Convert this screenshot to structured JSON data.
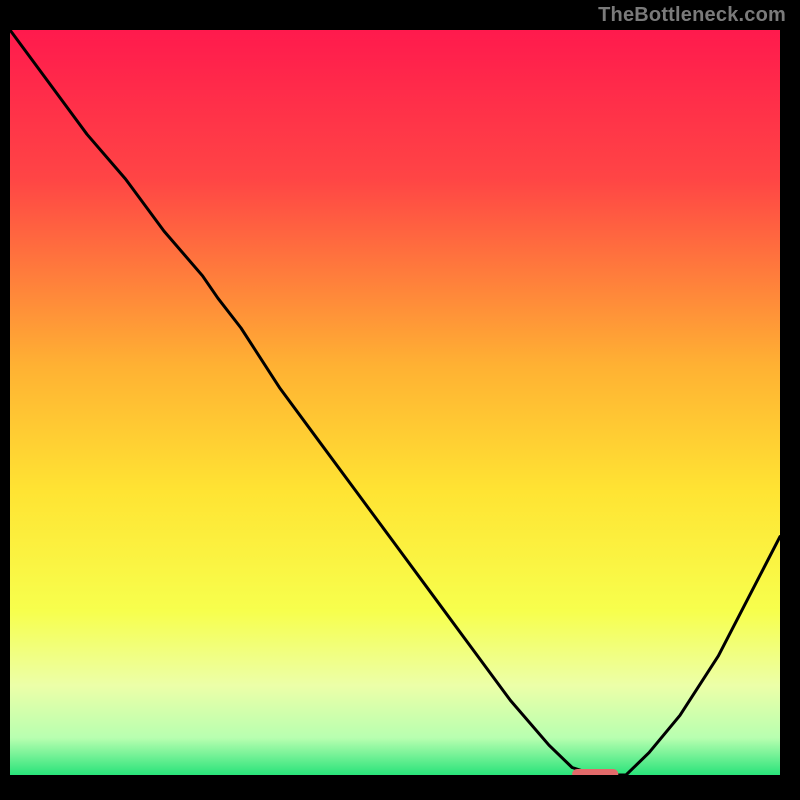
{
  "watermark": "TheBottleneck.com",
  "chart_data": {
    "type": "line",
    "title": "",
    "xlabel": "",
    "ylabel": "",
    "xlim": [
      0,
      100
    ],
    "ylim": [
      0,
      100
    ],
    "grid": false,
    "legend": false,
    "gradient_stops": [
      {
        "pos": 0.0,
        "color": "#ff1a4d"
      },
      {
        "pos": 0.2,
        "color": "#ff4545"
      },
      {
        "pos": 0.45,
        "color": "#ffb133"
      },
      {
        "pos": 0.62,
        "color": "#ffe433"
      },
      {
        "pos": 0.78,
        "color": "#f7ff4d"
      },
      {
        "pos": 0.88,
        "color": "#ecffa8"
      },
      {
        "pos": 0.95,
        "color": "#b8ffb0"
      },
      {
        "pos": 1.0,
        "color": "#29e37a"
      }
    ],
    "series": [
      {
        "name": "bottleneck-curve",
        "x": [
          0,
          5,
          10,
          15,
          20,
          25,
          27,
          30,
          35,
          40,
          45,
          50,
          55,
          60,
          65,
          70,
          73,
          76,
          78,
          80,
          83,
          87,
          92,
          96,
          100
        ],
        "y": [
          100,
          93,
          86,
          80,
          73,
          67,
          64,
          60,
          52,
          45,
          38,
          31,
          24,
          17,
          10,
          4,
          1,
          0,
          0,
          0,
          3,
          8,
          16,
          24,
          32
        ]
      }
    ],
    "marker": {
      "name": "optimal-range",
      "x_center": 76,
      "y": 0,
      "width_pct": 6,
      "color": "#e26a6a"
    }
  }
}
